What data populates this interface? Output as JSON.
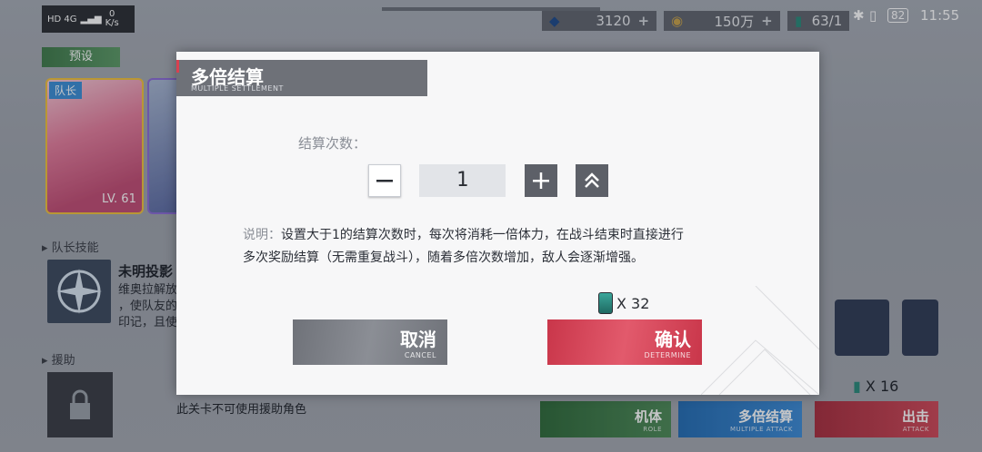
{
  "status_bar": {
    "network": "HD 4G",
    "speed_value": "0",
    "speed_unit": "K/s",
    "battery": "82",
    "time": "11:55"
  },
  "resources": [
    {
      "name": "crystal",
      "value": "3120"
    },
    {
      "name": "coin",
      "value": "150万"
    },
    {
      "name": "stamina",
      "value": "63/1"
    }
  ],
  "preset": {
    "label": "预设",
    "sub": "PRESETS"
  },
  "leader_card": {
    "tag": "队长",
    "level": "LV. 61"
  },
  "leader_skill": {
    "section_label": "队长技能",
    "name": "未明投影",
    "lines": [
      "维奥拉解放",
      "，使队友的",
      "印记，且使"
    ]
  },
  "assist": {
    "section_label": "援助",
    "note": "此关卡不可使用援助角色"
  },
  "bottom_buttons": [
    {
      "label": "机体",
      "sub": "ROLE",
      "color": "#3f7a4a"
    },
    {
      "label": "多倍结算",
      "sub": "MULTIPLE ATTACK",
      "color": "#2f7ec9"
    },
    {
      "label": "出击",
      "sub": "ATTACK",
      "color": "#c23848"
    }
  ],
  "attack_cost": "X 16",
  "dialog": {
    "title": "多倍结算",
    "subtitle": "MULTIPLE SETTLEMENT",
    "count_label": "结算次数：",
    "count_value": "1",
    "desc_label": "说明：",
    "desc_line1": "设置大于1的结算次数时，每次将消耗一倍体力，在战斗结束时直接进行",
    "desc_line2": "多次奖励结算（无需重复战斗），随着多倍次数增加，敌人会逐渐增强。",
    "cost": "X 32",
    "cancel_label": "取消",
    "cancel_sub": "CANCEL",
    "confirm_label": "确认",
    "confirm_sub": "DETERMINE"
  }
}
